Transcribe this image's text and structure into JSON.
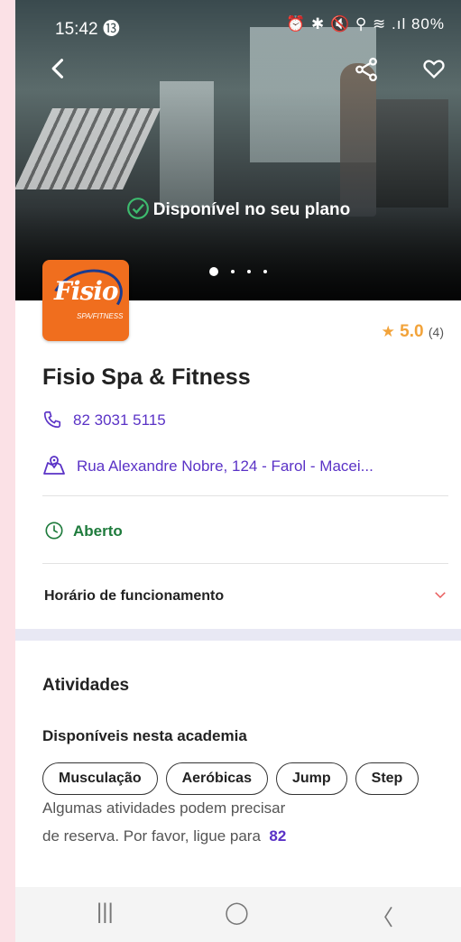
{
  "status_bar": {
    "time": "15:42",
    "indicators": "⓭",
    "right_icons": "⏰ ✱ 🔇 ⚲ ≋ .ıl 80%"
  },
  "hero": {
    "availability_label": "Disponível no seu plano",
    "carousel_count": 4,
    "carousel_active": 1
  },
  "logo": {
    "text": "Fisio",
    "sub": "SPA/FITNESS"
  },
  "rating": {
    "star": "★",
    "score": "5.0",
    "count": "(4)"
  },
  "gym": {
    "name": "Fisio Spa & Fitness",
    "phone": "82 3031 5115",
    "address": "Rua Alexandre Nobre, 124 - Farol - Macei..."
  },
  "status": {
    "open_label": "Aberto"
  },
  "hours": {
    "label": "Horário de funcionamento"
  },
  "activities": {
    "title": "Atividades",
    "subtitle": "Disponíveis nesta academia",
    "chips": [
      "Musculação",
      "Aeróbicas",
      "Jump",
      "Step"
    ],
    "note_line1": "Algumas atividades podem precisar",
    "note_line2": "de reserva. Por favor, ligue para",
    "note_phone": "82"
  },
  "nav": {
    "recent": "|||",
    "home": "◯",
    "back": "〈"
  },
  "colors": {
    "accent": "#5a32c6",
    "open": "#1e7b3c",
    "star": "#f2a33a",
    "logo_bg": "#f06e1e"
  }
}
